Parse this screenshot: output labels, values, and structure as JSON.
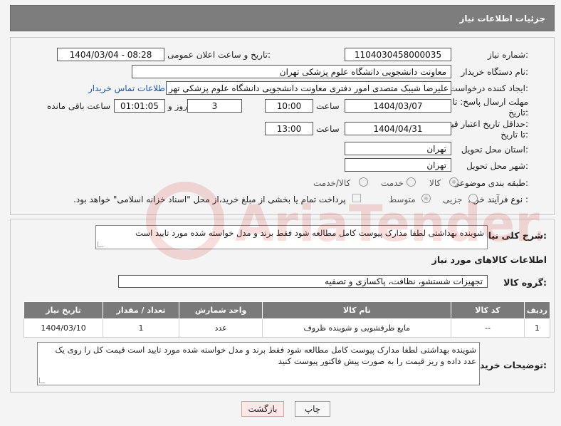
{
  "header": {
    "title": "جزئیات اطلاعات نیاز"
  },
  "form": {
    "need_number_label": "شماره نیاز:",
    "need_number": "1104030458000035",
    "announce_label": "تاریخ و ساعت اعلان عمومی:",
    "announce_value": "1404/03/04 - 08:28",
    "buyer_org_label": "نام دستگاه خریدار:",
    "buyer_org": "معاونت دانشجویی دانشگاه علوم پزشکی تهران",
    "creator_label": "ایجاد کننده درخواست:",
    "creator": "علیرضا شیبک متصدی امور دفتری معاونت دانشجویی دانشگاه علوم پزشکی تهر",
    "contact_link": "اطلاعات تماس خریدار",
    "deadline_label_1": "مهلت ارسال پاسخ: تا",
    "deadline_label_2": "تاریخ:",
    "deadline_date": "1404/03/07",
    "time_label": "ساعت",
    "deadline_time": "10:00",
    "days_value": "3",
    "days_label": "روز و",
    "remaining_value": "01:01:05",
    "remaining_label": "ساعت باقی مانده",
    "price_label_1": "حداقل تاریخ اعتبار قیمت:",
    "price_label_2": "تا تاریخ:",
    "price_date": "1404/04/31",
    "price_time": "13:00",
    "province_label": "استان محل تحویل:",
    "province": "تهران",
    "city_label": "شهر محل تحویل:",
    "city": "تهران",
    "category_label": "طبقه بندی موضوعی:",
    "category_options": [
      "کالا",
      "خدمت",
      "کالا/خدمت"
    ],
    "process_label": "نوع فرآیند خرید :",
    "process_options": [
      "جزیی",
      "متوسط"
    ],
    "payment_note": "پرداخت تمام یا بخشی از مبلغ خرید،از محل \"اسناد خزانه اسلامی\" خواهد بود."
  },
  "details": {
    "summary_label": "شرح کلی نیاز:",
    "summary_text": "شوینده بهداشتی لطفا مدارک پیوست کامل مطالعه شود فقط برند و مدل خواسته شده مورد تایید است",
    "goods_info_title": "اطلاعات کالاهای مورد نیاز",
    "goods_group_label": "گروه کالا:",
    "goods_group": "تجهیزات شستشو، نظافت، پاکسازی و تصفیه",
    "table_headers": [
      "ردیف",
      "کد کالا",
      "نام کالا",
      "واحد شمارش",
      "تعداد / مقدار",
      "تاریخ نیاز"
    ],
    "table_rows": [
      [
        "1",
        "--",
        "مایع ظرفشویی و شوینده ظروف",
        "عدد",
        "1",
        "1404/03/10"
      ]
    ],
    "buyer_notes_label": "توضیحات خریدار:",
    "buyer_notes": "شوینده بهداشتی لطفا مدارک پیوست کامل مطالعه شود فقط برند و مدل خواسته شده مورد تایید است قیمت کل را روی یک عدد داده و ریز قیمت را  به صورت پیش فاکتور پیوست کنید"
  },
  "buttons": {
    "print": "چاپ",
    "back": "بازگشت"
  },
  "watermark": {
    "text": "AriaTender.net"
  }
}
